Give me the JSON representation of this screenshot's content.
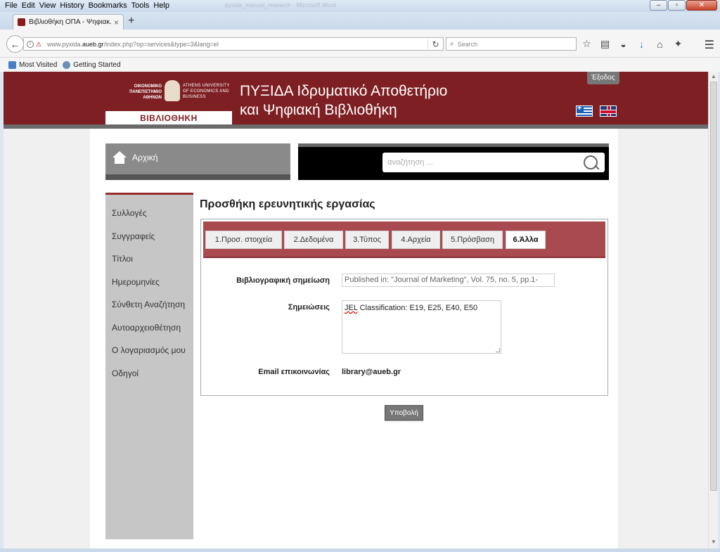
{
  "browser": {
    "menu": [
      "File",
      "Edit",
      "View",
      "History",
      "Bookmarks",
      "Tools",
      "Help"
    ],
    "window_title": "pyxida_manual_research - Microsoft Word",
    "tab_title": "Βιβλιοθήκη ΟΠΑ - Ψηφιακ...",
    "url_prefix": "www.pyxida.",
    "url_domain": "aueb.gr",
    "url_path": "/index.php?op=services&type=3&lang=el",
    "search_placeholder": "Search",
    "bookmarks": [
      "Most Visited",
      "Getting Started"
    ]
  },
  "header": {
    "logo_greek": "ΟΙΚΟΝΟΜΙΚΟ ΠΑΝΕΠΙΣΤΗΜΙΟ ΑΘΗΝΩΝ",
    "logo_english": "ATHENS UNIVERSITY OF ECONOMICS AND BUSINESS",
    "logo_library": "ΒΙΒΛΙΟΘΗΚΗ",
    "title_line1": "ΠΥΞΙΔΑ Ιδρυματικό Αποθετήριο",
    "title_line2": "και Ψηφιακή Βιβλιοθήκη",
    "exit_label": "Έξοδος"
  },
  "nav": {
    "home_label": "Αρχική",
    "search_placeholder": "αναζήτηση ..."
  },
  "sidebar": {
    "items": [
      "Συλλογές",
      "Συγγραφείς",
      "Τίτλοι",
      "Ημερομηνίες",
      "Σύνθετη Αναζήτηση",
      "Αυτοαρχειοθέτηση",
      "Ο λογαριασμός μου",
      "Οδηγοί"
    ]
  },
  "form": {
    "heading": "Προσθήκη ερευνητικής εργασίας",
    "tabs": [
      "1.Προσ. στοιχεία",
      "2.Δεδομένα",
      "3.Τύπος",
      "4.Αρχεία",
      "5.Πρόσβαση",
      "6.Άλλα"
    ],
    "active_tab": 5,
    "fields": {
      "citation_label": "Βιβλιογραφική σημείωση",
      "citation_value": "Published in: \"Journal of Marketing\", Vol. 75, no. 5, pp.1-",
      "notes_label": "Σημειώσεις",
      "notes_value_prefix": "JEL",
      "notes_value_rest": " Classification: E19, E25, E40, E50",
      "email_label": "Email επικοινωνίας",
      "email_value": "library@aueb.gr"
    },
    "submit_label": "Υποβολή"
  },
  "colors": {
    "brand": "#7e1f23",
    "wizard_band": "#a84a50",
    "sidebar_bg": "#c6c6c6"
  }
}
